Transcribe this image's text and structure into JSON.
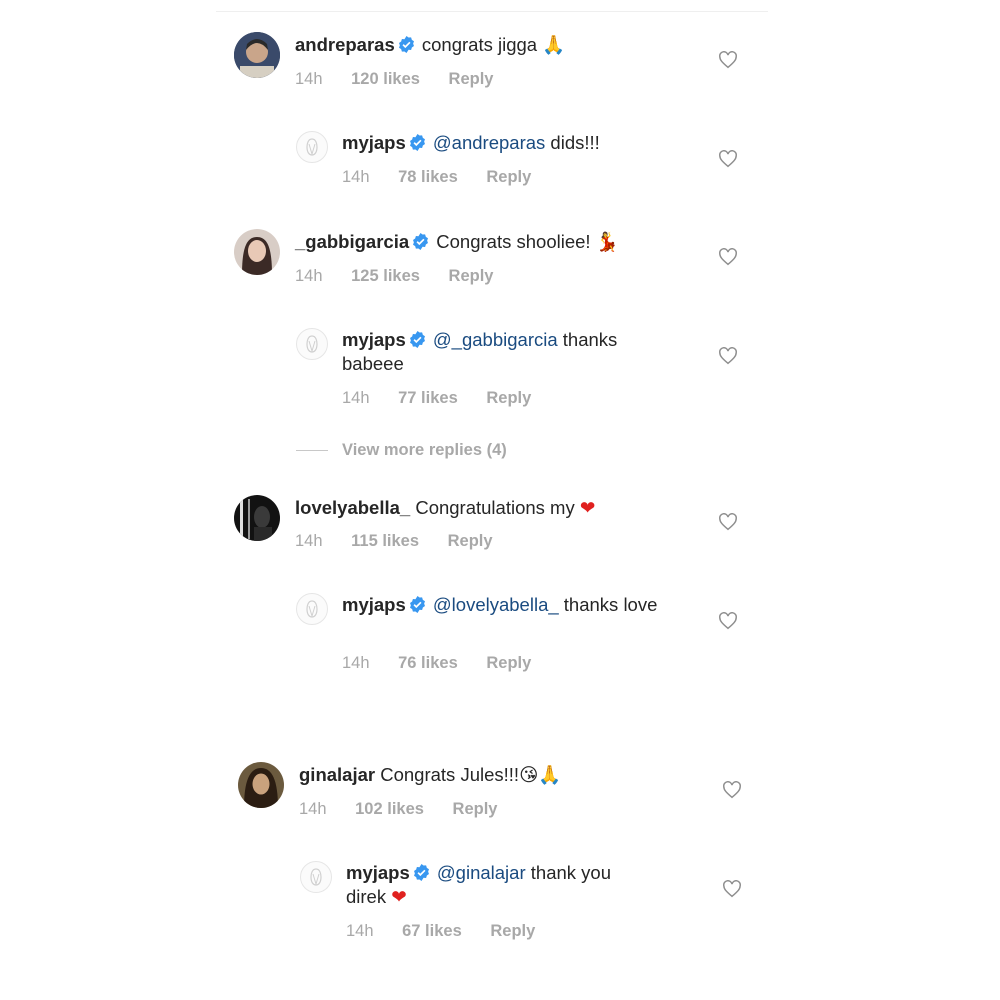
{
  "comments": [
    {
      "user": "andreparas",
      "verified": true,
      "text": "congrats jigga",
      "emoji": "🙏",
      "time": "14h",
      "likes": "120 likes",
      "reply": "Reply",
      "avatar_color": "#2d3b58"
    },
    {
      "user": "myjaps",
      "verified": true,
      "mention": "@andreparas",
      "text": "dids!!!",
      "time": "14h",
      "likes": "78 likes",
      "reply": "Reply"
    },
    {
      "user": "_gabbigarcia",
      "verified": true,
      "text": "Congrats shooliee!",
      "emoji": "💃",
      "time": "14h",
      "likes": "125 likes",
      "reply": "Reply",
      "avatar_color": "#7e6b6a"
    },
    {
      "user": "myjaps",
      "verified": true,
      "mention": "@_gabbigarcia",
      "text": "thanks babeee",
      "time": "14h",
      "likes": "77 likes",
      "reply": "Reply"
    },
    {
      "view_more": "View more replies (4)"
    },
    {
      "user": "lovelyabella_",
      "verified": false,
      "text": "Congratulations my",
      "emoji": "❤",
      "time": "14h",
      "likes": "115 likes",
      "reply": "Reply",
      "avatar_color": "#1b1b1b"
    },
    {
      "user": "myjaps",
      "verified": true,
      "mention": "@lovelyabella_",
      "text": "thanks love",
      "time": "14h",
      "likes": "76 likes",
      "reply": "Reply"
    },
    {
      "user": "ginalajar",
      "verified": false,
      "text": "Congrats Jules!!!",
      "emoji": "😘🙏",
      "time": "14h",
      "likes": "102 likes",
      "reply": "Reply",
      "avatar_color": "#5a4632"
    },
    {
      "user": "myjaps",
      "verified": true,
      "mention": "@ginalajar",
      "text": "thank you direk",
      "emoji": "❤",
      "time": "14h",
      "likes": "67 likes",
      "reply": "Reply"
    }
  ],
  "colors": {
    "verified": "#3897f0",
    "mention": "#1a4b80",
    "meta": "#a8a8a8",
    "heart_emoji": "#e0211f"
  },
  "icons": {
    "verified": "verified-badge-icon",
    "like": "heart-outline-icon"
  }
}
